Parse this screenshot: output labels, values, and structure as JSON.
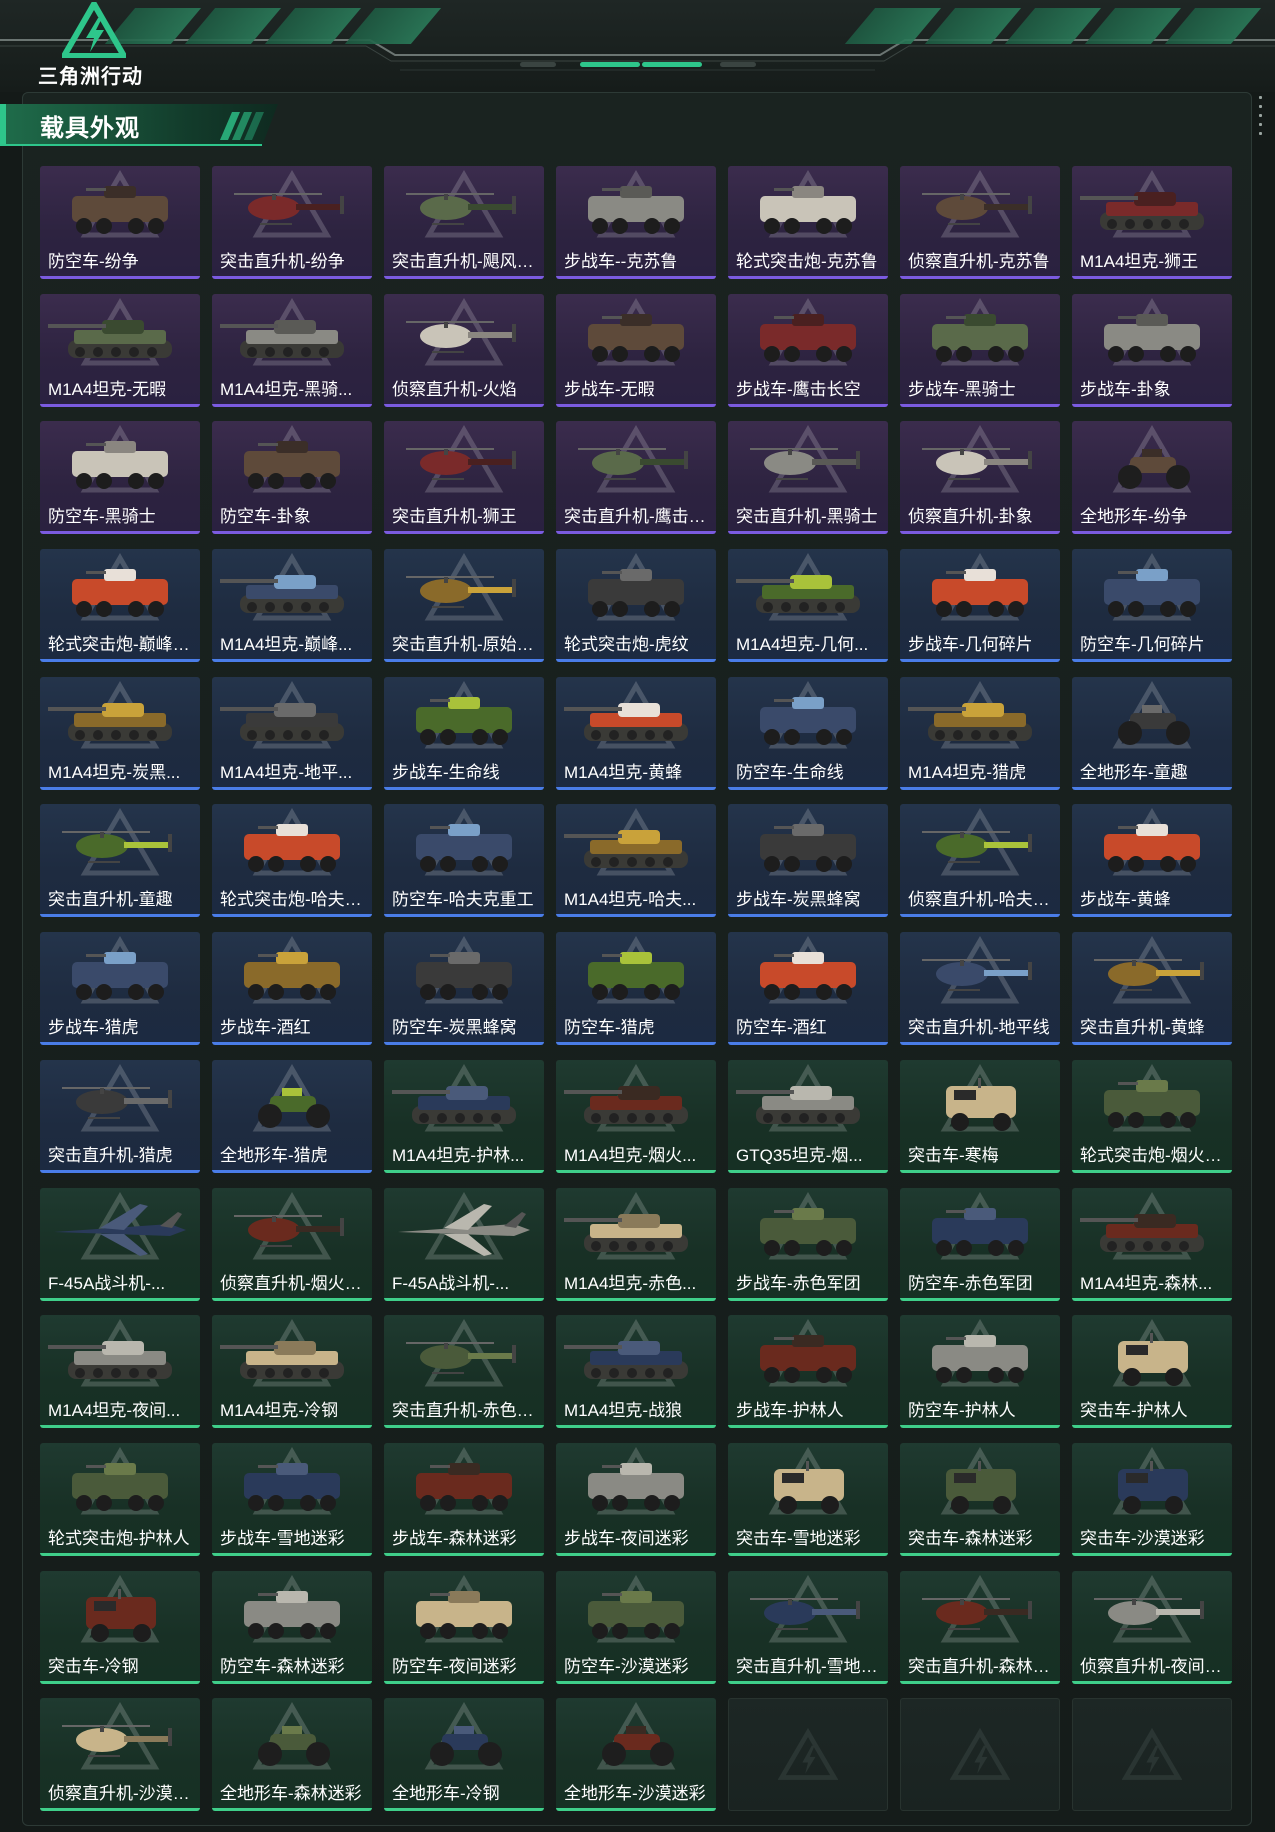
{
  "header": {
    "logo_text": "三角洲行动",
    "accent": "#2ec68b"
  },
  "section": {
    "title": "载具外观"
  },
  "colors": {
    "purple_rarity": "#7b5be0",
    "blue_rarity": "#4a7de8",
    "green_rarity": "#3fcf8a"
  },
  "items": [
    {
      "label": "防空车-纷争",
      "rarity": "purple",
      "type": "apc"
    },
    {
      "label": "突击直升机-纷争",
      "rarity": "purple",
      "type": "heli"
    },
    {
      "label": "突击直升机-飓风行...",
      "rarity": "purple",
      "type": "heli"
    },
    {
      "label": "步战车--克苏鲁",
      "rarity": "purple",
      "type": "apc"
    },
    {
      "label": "轮式突击炮-克苏鲁",
      "rarity": "purple",
      "type": "apc"
    },
    {
      "label": "侦察直升机-克苏鲁",
      "rarity": "purple",
      "type": "heli"
    },
    {
      "label": "M1A4坦克-狮王",
      "rarity": "purple",
      "type": "tank"
    },
    {
      "label": "M1A4坦克-无暇",
      "rarity": "purple",
      "type": "tank"
    },
    {
      "label": "M1A4坦克-黑骑...",
      "rarity": "purple",
      "type": "tank"
    },
    {
      "label": "侦察直升机-火焰",
      "rarity": "purple",
      "type": "heli"
    },
    {
      "label": "步战车-无暇",
      "rarity": "purple",
      "type": "apc"
    },
    {
      "label": "步战车-鹰击长空",
      "rarity": "purple",
      "type": "apc"
    },
    {
      "label": "步战车-黑骑士",
      "rarity": "purple",
      "type": "apc"
    },
    {
      "label": "步战车-卦象",
      "rarity": "purple",
      "type": "apc"
    },
    {
      "label": "防空车-黑骑士",
      "rarity": "purple",
      "type": "apc"
    },
    {
      "label": "防空车-卦象",
      "rarity": "purple",
      "type": "apc"
    },
    {
      "label": "突击直升机-狮王",
      "rarity": "purple",
      "type": "heli"
    },
    {
      "label": "突击直升机-鹰击长...",
      "rarity": "purple",
      "type": "heli"
    },
    {
      "label": "突击直升机-黑骑士",
      "rarity": "purple",
      "type": "heli"
    },
    {
      "label": "侦察直升机-卦象",
      "rarity": "purple",
      "type": "heli"
    },
    {
      "label": "全地形车-纷争",
      "rarity": "purple",
      "type": "atv"
    },
    {
      "label": "轮式突击炮-巅峰竞...",
      "rarity": "blue",
      "type": "apc"
    },
    {
      "label": "M1A4坦克-巅峰...",
      "rarity": "blue",
      "type": "tank"
    },
    {
      "label": "突击直升机-原始伪...",
      "rarity": "blue",
      "type": "heli"
    },
    {
      "label": "轮式突击炮-虎纹",
      "rarity": "blue",
      "type": "apc"
    },
    {
      "label": "M1A4坦克-几何...",
      "rarity": "blue",
      "type": "tank"
    },
    {
      "label": "步战车-几何碎片",
      "rarity": "blue",
      "type": "apc"
    },
    {
      "label": "防空车-几何碎片",
      "rarity": "blue",
      "type": "apc"
    },
    {
      "label": "M1A4坦克-炭黑...",
      "rarity": "blue",
      "type": "tank"
    },
    {
      "label": "M1A4坦克-地平...",
      "rarity": "blue",
      "type": "tank"
    },
    {
      "label": "步战车-生命线",
      "rarity": "blue",
      "type": "apc"
    },
    {
      "label": "M1A4坦克-黄蜂",
      "rarity": "blue",
      "type": "tank"
    },
    {
      "label": "防空车-生命线",
      "rarity": "blue",
      "type": "apc"
    },
    {
      "label": "M1A4坦克-猎虎",
      "rarity": "blue",
      "type": "tank"
    },
    {
      "label": "全地形车-童趣",
      "rarity": "blue",
      "type": "atv"
    },
    {
      "label": "突击直升机-童趣",
      "rarity": "blue",
      "type": "heli"
    },
    {
      "label": "轮式突击炮-哈夫克...",
      "rarity": "blue",
      "type": "apc"
    },
    {
      "label": "防空车-哈夫克重工",
      "rarity": "blue",
      "type": "apc"
    },
    {
      "label": "M1A4坦克-哈夫...",
      "rarity": "blue",
      "type": "tank"
    },
    {
      "label": "步战车-炭黑蜂窝",
      "rarity": "blue",
      "type": "apc"
    },
    {
      "label": "侦察直升机-哈夫克...",
      "rarity": "blue",
      "type": "heli"
    },
    {
      "label": "步战车-黄蜂",
      "rarity": "blue",
      "type": "apc"
    },
    {
      "label": "步战车-猎虎",
      "rarity": "blue",
      "type": "apc"
    },
    {
      "label": "步战车-酒红",
      "rarity": "blue",
      "type": "apc"
    },
    {
      "label": "防空车-炭黑蜂窝",
      "rarity": "blue",
      "type": "apc"
    },
    {
      "label": "防空车-猎虎",
      "rarity": "blue",
      "type": "apc"
    },
    {
      "label": "防空车-酒红",
      "rarity": "blue",
      "type": "apc"
    },
    {
      "label": "突击直升机-地平线",
      "rarity": "blue",
      "type": "heli"
    },
    {
      "label": "突击直升机-黄蜂",
      "rarity": "blue",
      "type": "heli"
    },
    {
      "label": "突击直升机-猎虎",
      "rarity": "blue",
      "type": "heli"
    },
    {
      "label": "全地形车-猎虎",
      "rarity": "blue",
      "type": "atv"
    },
    {
      "label": "M1A4坦克-护林...",
      "rarity": "green",
      "type": "tank"
    },
    {
      "label": "M1A4坦克-烟火...",
      "rarity": "green",
      "type": "tank"
    },
    {
      "label": "GTQ35坦克-烟...",
      "rarity": "green",
      "type": "tank"
    },
    {
      "label": "突击车-寒梅",
      "rarity": "green",
      "type": "truck"
    },
    {
      "label": "轮式突击炮-烟火2...",
      "rarity": "green",
      "type": "apc"
    },
    {
      "label": "F-45A战斗机-...",
      "rarity": "green",
      "type": "jet"
    },
    {
      "label": "侦察直升机-烟火2...",
      "rarity": "green",
      "type": "heli"
    },
    {
      "label": "F-45A战斗机-...",
      "rarity": "green",
      "type": "jet"
    },
    {
      "label": "M1A4坦克-赤色...",
      "rarity": "green",
      "type": "tank"
    },
    {
      "label": "步战车-赤色军团",
      "rarity": "green",
      "type": "apc"
    },
    {
      "label": "防空车-赤色军团",
      "rarity": "green",
      "type": "apc"
    },
    {
      "label": "M1A4坦克-森林...",
      "rarity": "green",
      "type": "tank"
    },
    {
      "label": "M1A4坦克-夜间...",
      "rarity": "green",
      "type": "tank"
    },
    {
      "label": "M1A4坦克-冷钢",
      "rarity": "green",
      "type": "tank"
    },
    {
      "label": "突击直升机-赤色军...",
      "rarity": "green",
      "type": "heli"
    },
    {
      "label": "M1A4坦克-战狼",
      "rarity": "green",
      "type": "tank"
    },
    {
      "label": "步战车-护林人",
      "rarity": "green",
      "type": "apc"
    },
    {
      "label": "防空车-护林人",
      "rarity": "green",
      "type": "apc"
    },
    {
      "label": "突击车-护林人",
      "rarity": "green",
      "type": "truck"
    },
    {
      "label": "轮式突击炮-护林人",
      "rarity": "green",
      "type": "apc"
    },
    {
      "label": "步战车-雪地迷彩",
      "rarity": "green",
      "type": "apc"
    },
    {
      "label": "步战车-森林迷彩",
      "rarity": "green",
      "type": "apc"
    },
    {
      "label": "步战车-夜间迷彩",
      "rarity": "green",
      "type": "apc"
    },
    {
      "label": "突击车-雪地迷彩",
      "rarity": "green",
      "type": "truck"
    },
    {
      "label": "突击车-森林迷彩",
      "rarity": "green",
      "type": "truck"
    },
    {
      "label": "突击车-沙漠迷彩",
      "rarity": "green",
      "type": "truck"
    },
    {
      "label": "突击车-冷钢",
      "rarity": "green",
      "type": "truck"
    },
    {
      "label": "防空车-森林迷彩",
      "rarity": "green",
      "type": "apc"
    },
    {
      "label": "防空车-夜间迷彩",
      "rarity": "green",
      "type": "apc"
    },
    {
      "label": "防空车-沙漠迷彩",
      "rarity": "green",
      "type": "apc"
    },
    {
      "label": "突击直升机-雪地迷...",
      "rarity": "green",
      "type": "heli"
    },
    {
      "label": "突击直升机-森林迷...",
      "rarity": "green",
      "type": "heli"
    },
    {
      "label": "侦察直升机-夜间迷...",
      "rarity": "green",
      "type": "heli"
    },
    {
      "label": "侦察直升机-沙漠迷...",
      "rarity": "green",
      "type": "heli"
    },
    {
      "label": "全地形车-森林迷彩",
      "rarity": "green",
      "type": "atv"
    },
    {
      "label": "全地形车-冷钢",
      "rarity": "green",
      "type": "atv"
    },
    {
      "label": "全地形车-沙漠迷彩",
      "rarity": "green",
      "type": "atv"
    },
    {
      "label": "",
      "rarity": "empty",
      "type": "empty"
    },
    {
      "label": "",
      "rarity": "empty",
      "type": "empty"
    },
    {
      "label": "",
      "rarity": "empty",
      "type": "empty"
    }
  ]
}
